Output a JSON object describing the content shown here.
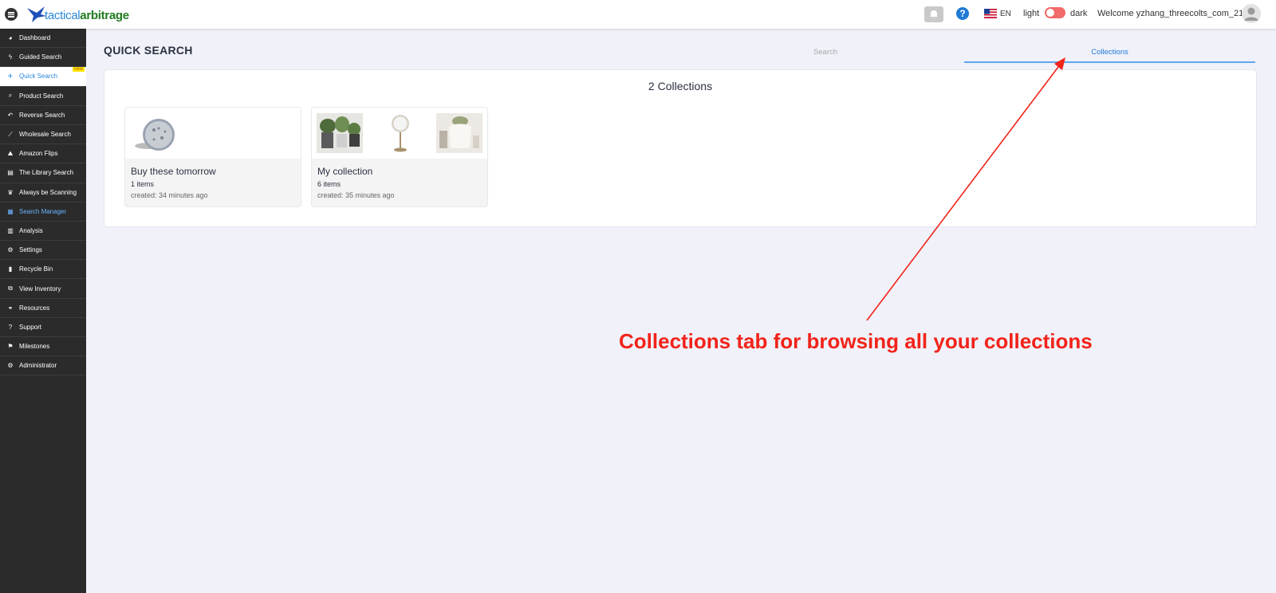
{
  "logo": {
    "part1": "tactical",
    "part2": "arbitrage"
  },
  "header": {
    "lang": "EN",
    "light_label": "light",
    "dark_label": "dark",
    "welcome": "Welcome yzhang_threecolts_com_2123",
    "help_glyph": "?",
    "icons": {
      "menu": "hamburger-menu-icon",
      "bell": "bell-icon",
      "help": "help-icon",
      "flag": "us-flag-icon",
      "avatar": "user-avatar-icon"
    }
  },
  "sidebar": {
    "items": [
      {
        "label": "Dashboard",
        "icon": "dashboard-icon"
      },
      {
        "label": "Guided Search",
        "icon": "lightning-icon"
      },
      {
        "label": "Quick Search",
        "icon": "plane-icon",
        "active": true,
        "badge": "new"
      },
      {
        "label": "Product Search",
        "icon": "search-icon"
      },
      {
        "label": "Reverse Search",
        "icon": "reverse-arrow-icon"
      },
      {
        "label": "Wholesale Search",
        "icon": "chart-line-icon"
      },
      {
        "label": "Amazon Flips",
        "icon": "road-icon"
      },
      {
        "label": "The Library Search",
        "icon": "book-icon"
      },
      {
        "label": "Always be Scanning",
        "icon": "trophy-icon"
      },
      {
        "label": "Search Manager",
        "icon": "table-icon",
        "highlight": true
      },
      {
        "label": "Analysis",
        "icon": "columns-icon"
      },
      {
        "label": "Settings",
        "icon": "gear-icon"
      },
      {
        "label": "Recycle Bin",
        "icon": "trash-icon"
      },
      {
        "label": "View Inventory",
        "icon": "boxes-icon"
      },
      {
        "label": "Resources",
        "icon": "handshake-icon"
      },
      {
        "label": "Support",
        "icon": "question-icon"
      },
      {
        "label": "Milestones",
        "icon": "flag-icon"
      },
      {
        "label": "Administrator",
        "icon": "gears-icon"
      }
    ]
  },
  "main": {
    "title": "QUICK SEARCH",
    "tabs": [
      {
        "label": "Search"
      },
      {
        "label": "Collections",
        "active": true
      }
    ],
    "collections_count": "2 Collections",
    "collections": [
      {
        "name": "Buy these tomorrow",
        "items": "1 items",
        "created": "created: 34 minutes ago"
      },
      {
        "name": "My collection",
        "items": "6 items",
        "created": "created: 35 minutes ago"
      }
    ]
  },
  "annotation": {
    "text": "Collections tab for browsing all your collections",
    "color": "#f2231a"
  },
  "colors": {
    "accent": "#1f7ad6",
    "sidebar": "#2b2b2b",
    "background": "#f0f1f9",
    "toggle": "#f26a6a"
  }
}
